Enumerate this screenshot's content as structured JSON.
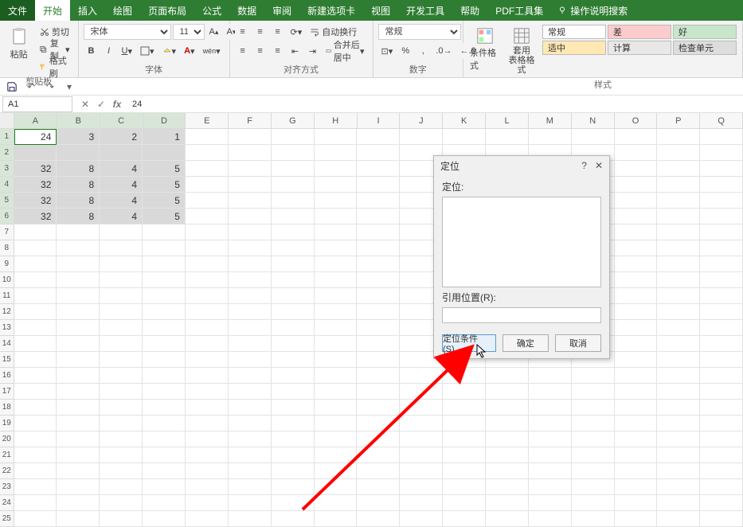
{
  "menu": {
    "file": "文件",
    "home": "开始",
    "insert": "插入",
    "draw": "绘图",
    "layout": "页面布局",
    "formula": "公式",
    "data": "数据",
    "review": "审阅",
    "newtab": "新建选项卡",
    "view": "视图",
    "dev": "开发工具",
    "help": "帮助",
    "pdf": "PDF工具集",
    "search": "操作说明搜索"
  },
  "ribbon": {
    "clipboard": {
      "cut": "剪切",
      "copy": "复制",
      "brush": "格式刷",
      "paste": "粘贴",
      "label": "剪贴板"
    },
    "font": {
      "name": "宋体",
      "size": "11",
      "label": "字体"
    },
    "align": {
      "wrap": "自动换行",
      "merge": "合并后居中",
      "label": "对齐方式"
    },
    "number": {
      "format": "常规",
      "label": "数字"
    },
    "cond": {
      "cond": "条件格式",
      "table": "套用\n表格格式",
      "styles": {
        "normal": "常规",
        "bad": "差",
        "good": "好",
        "neutral": "适中",
        "calc": "计算",
        "check": "检查单元"
      },
      "label": "样式"
    }
  },
  "fbar": {
    "name": "A1",
    "formula": "24"
  },
  "columns": [
    "A",
    "B",
    "C",
    "D",
    "E",
    "F",
    "G",
    "H",
    "I",
    "J",
    "K",
    "L",
    "M",
    "N",
    "O",
    "P",
    "Q"
  ],
  "data_rows": [
    [
      "24",
      "3",
      "2",
      "1"
    ],
    [
      "",
      "",
      "",
      ""
    ],
    [
      "32",
      "8",
      "4",
      "5"
    ],
    [
      "32",
      "8",
      "4",
      "5"
    ],
    [
      "32",
      "8",
      "4",
      "5"
    ],
    [
      "32",
      "8",
      "4",
      "5"
    ]
  ],
  "dialog": {
    "title": "定位",
    "listlabel": "定位:",
    "reflabel": "引用位置(R):",
    "special": "定位条件(S)...",
    "ok": "确定",
    "cancel": "取消"
  }
}
